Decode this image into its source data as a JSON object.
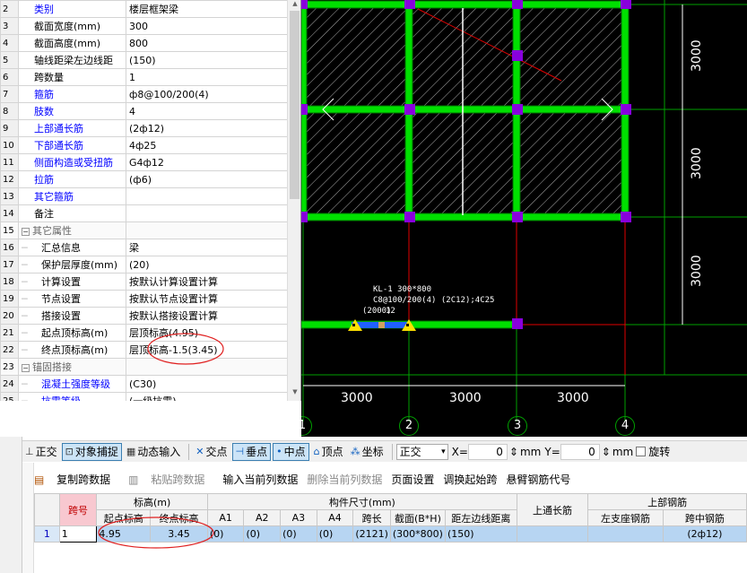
{
  "properties": [
    {
      "num": "2",
      "name": "类别",
      "value": "楼层框架梁",
      "blue": true
    },
    {
      "num": "3",
      "name": "截面宽度(mm)",
      "value": "300",
      "blue": false
    },
    {
      "num": "4",
      "name": "截面高度(mm)",
      "value": "800",
      "blue": false
    },
    {
      "num": "5",
      "name": "轴线距梁左边线距",
      "value": "(150)",
      "blue": false
    },
    {
      "num": "6",
      "name": "跨数量",
      "value": "1",
      "blue": false
    },
    {
      "num": "7",
      "name": "箍筋",
      "value": "ф8@100/200(4)",
      "blue": true
    },
    {
      "num": "8",
      "name": "肢数",
      "value": "4",
      "blue": true
    },
    {
      "num": "9",
      "name": "上部通长筋",
      "value": "(2ф12)",
      "blue": true
    },
    {
      "num": "10",
      "name": "下部通长筋",
      "value": "4ф25",
      "blue": true
    },
    {
      "num": "11",
      "name": "侧面构造或受扭筋",
      "value": "G4ф12",
      "blue": true
    },
    {
      "num": "12",
      "name": "拉筋",
      "value": "(ф6)",
      "blue": true
    },
    {
      "num": "13",
      "name": "其它箍筋",
      "value": "",
      "blue": true
    },
    {
      "num": "14",
      "name": "备注",
      "value": "",
      "blue": false
    },
    {
      "num": "15",
      "name": "其它属性",
      "value": "",
      "group": true,
      "sign": "−"
    },
    {
      "num": "16",
      "name": "汇总信息",
      "value": "梁",
      "child": true
    },
    {
      "num": "17",
      "name": "保护层厚度(mm)",
      "value": "(20)",
      "child": true
    },
    {
      "num": "18",
      "name": "计算设置",
      "value": "按默认计算设置计算",
      "child": true
    },
    {
      "num": "19",
      "name": "节点设置",
      "value": "按默认节点设置计算",
      "child": true
    },
    {
      "num": "20",
      "name": "搭接设置",
      "value": "按默认搭接设置计算",
      "child": true
    },
    {
      "num": "21",
      "name": "起点顶标高(m)",
      "value": "层顶标高(4.95)",
      "child": true
    },
    {
      "num": "22",
      "name": "终点顶标高(m)",
      "value": "层顶标高-1.5(3.45)",
      "child": true
    },
    {
      "num": "23",
      "name": "锚固搭接",
      "value": "",
      "group": true,
      "sign": "−"
    },
    {
      "num": "24",
      "name": "混凝土强度等级",
      "value": "(C30)",
      "child": true,
      "blue": true
    },
    {
      "num": "25",
      "name": "抗震等级",
      "value": "(一级抗震)",
      "child": true,
      "blue": true
    }
  ],
  "canvas": {
    "dims_bottom": [
      "3000",
      "3000",
      "3000"
    ],
    "dims_right": [
      "3000",
      "3000",
      "3000"
    ],
    "axes": [
      "1",
      "2",
      "3",
      "4"
    ],
    "beam_label_1": "KL-1  300*800",
    "beam_label_2": "C8@100/200(4)  (2C12);4C25",
    "beam_label_3": "(2000)",
    "beam_label_4": "12"
  },
  "snapbar": {
    "orth": "正交",
    "object_snap": "对象捕捉",
    "dynamic_input": "动态输入",
    "intersection": "交点",
    "perpendicular": "垂点",
    "midpoint": "中点",
    "vertex": "顶点",
    "coordinate": "坐标",
    "mode_select": "正交",
    "x_label": "X=",
    "x_value": "0",
    "y_label": "Y=",
    "y_value": "0",
    "unit": "mm",
    "unit2": "mm",
    "rotate": "旋转"
  },
  "editbar": {
    "copy_span": "复制跨数据",
    "paste_span": "粘贴跨数据",
    "input_col": "输入当前列数据",
    "delete_col": "删除当前列数据",
    "page_setup": "页面设置",
    "swap_start": "调换起始跨",
    "cantilever": "悬臂钢筋代号"
  },
  "span_table": {
    "headers": {
      "span_no": "跨号",
      "elevation": "标高(m)",
      "start_el": "起点标高",
      "end_el": "终点标高",
      "size": "构件尺寸(mm)",
      "a1": "A1",
      "a2": "A2",
      "a3": "A3",
      "a4": "A4",
      "span_len": "跨长",
      "section": "截面(B*H)",
      "edge_dist": "距左边线距离",
      "top_through": "上通长筋",
      "top_rebar": "上部钢筋",
      "left_support": "左支座钢筋",
      "mid_span": "跨中钢筋"
    },
    "row": {
      "row_num": "1",
      "span_no": "1",
      "start_el": "4.95",
      "end_el": "3.45",
      "a1": "(0)",
      "a2": "(0)",
      "a3": "(0)",
      "a4": "(0)",
      "span_len": "(2121)",
      "section": "(300*800)",
      "edge_dist": "(150)",
      "top_through": "",
      "left_support": "",
      "mid_span": "(2ф12)"
    }
  }
}
